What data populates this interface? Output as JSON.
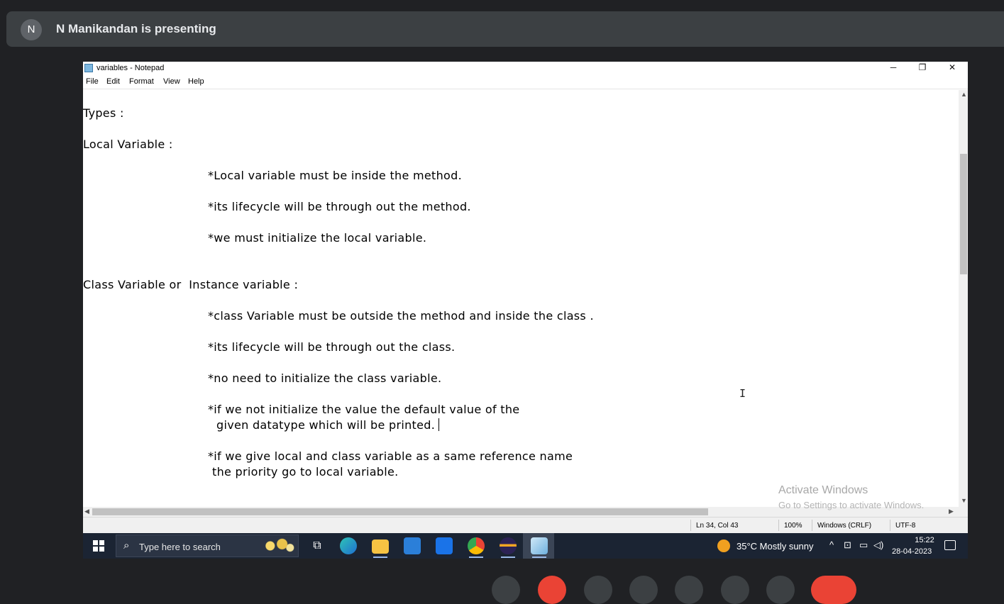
{
  "meet": {
    "avatar_letter": "N",
    "presenting": "N Manikandan is presenting"
  },
  "window": {
    "title": "variables - Notepad",
    "minimize": "─",
    "restore": "❐",
    "close": "✕"
  },
  "menu": [
    "File",
    "Edit",
    "Format",
    "View",
    "Help"
  ],
  "content": {
    "lines": [
      "Types :",
      "Local Variable :",
      "*Local variable must be inside the method.",
      "*its lifecycle will be through out the method.",
      "*we must initialize the local variable.",
      "Class Variable or  Instance variable :",
      "*class Variable must be outside the method and inside the class .",
      "*its lifecycle will be through out the class.",
      "*no need to initialize the class variable.",
      "*if we not initialize the value the default value of the",
      "given datatype which will be printed. ",
      "*if we give local and class variable as a same reference name",
      "the priority go to local variable."
    ]
  },
  "activation": {
    "title": "Activate Windows",
    "subtitle": "Go to Settings to activate Windows."
  },
  "status": {
    "position": "Ln 34, Col 43",
    "zoom": "100%",
    "line_ending": "Windows (CRLF)",
    "encoding": "UTF-8"
  },
  "taskbar": {
    "search_placeholder": "Type here to search",
    "weather": "35°C  Mostly sunny",
    "time": "15:22",
    "date": "28-04-2023",
    "icons": [
      "start-icon",
      "search-icon",
      "task-view-icon",
      "edge-icon",
      "file-explorer-icon",
      "store-icon",
      "mail-icon",
      "chrome-icon",
      "eclipse-icon",
      "notepad-icon"
    ]
  }
}
